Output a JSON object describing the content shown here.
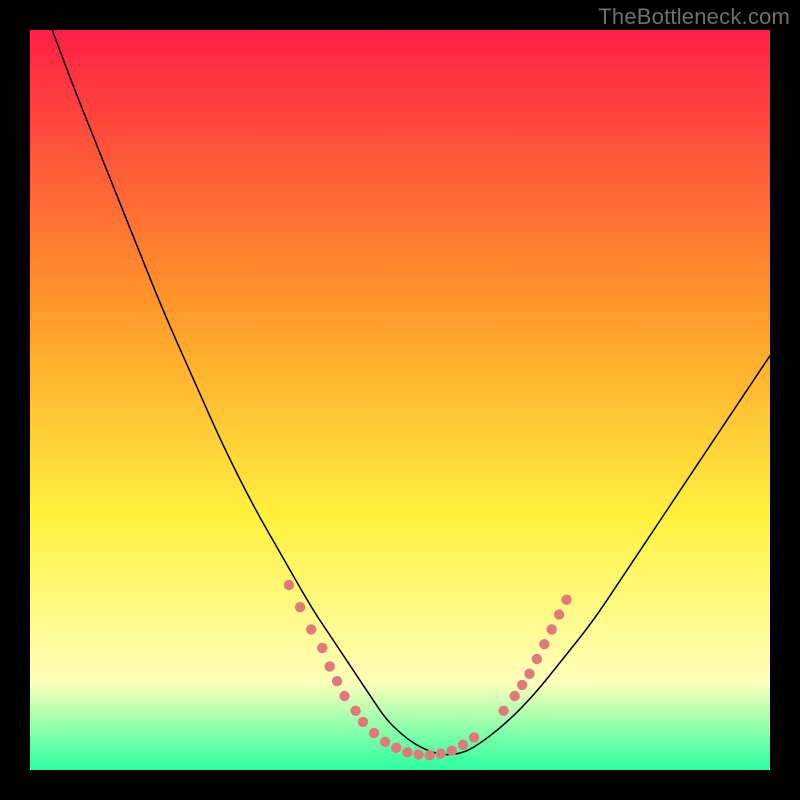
{
  "watermark": "TheBottleneck.com",
  "chart_data": {
    "type": "line",
    "title": "",
    "xlabel": "",
    "ylabel": "",
    "xlim": [
      0,
      100
    ],
    "ylim": [
      0,
      100
    ],
    "grid": false,
    "legend": false,
    "background_gradient": {
      "top": "#ff1f46",
      "mid1": "#ff9a2a",
      "mid2": "#fff23e",
      "mid3": "#ffffbb",
      "bottom": "#2aff9f"
    },
    "series": [
      {
        "name": "bottleneck-curve",
        "color": "#000000",
        "stroke_width": 1.5,
        "x": [
          3,
          6,
          10,
          14,
          18,
          22,
          26,
          30,
          34,
          38,
          40,
          42,
          44,
          46,
          48,
          50,
          52,
          54,
          56,
          58,
          60,
          64,
          68,
          72,
          76,
          80,
          84,
          88,
          92,
          96,
          100
        ],
        "y": [
          100,
          92,
          82,
          72,
          62,
          53,
          44,
          36,
          29,
          22,
          19,
          16,
          13,
          10,
          7,
          5,
          3.5,
          2.5,
          2,
          2.2,
          3,
          6,
          10,
          15,
          20,
          26,
          32,
          38,
          44,
          50,
          56
        ]
      }
    ],
    "markers": {
      "name": "highlight-dots",
      "color": "#e07a7a",
      "radius": 5.2,
      "threshold_y": 24,
      "points": [
        {
          "x": 35,
          "y": 25
        },
        {
          "x": 36.5,
          "y": 22
        },
        {
          "x": 38,
          "y": 19
        },
        {
          "x": 39.5,
          "y": 16.5
        },
        {
          "x": 40.5,
          "y": 14
        },
        {
          "x": 41.5,
          "y": 12
        },
        {
          "x": 42.5,
          "y": 10
        },
        {
          "x": 44,
          "y": 8
        },
        {
          "x": 45,
          "y": 6.5
        },
        {
          "x": 46.5,
          "y": 5
        },
        {
          "x": 48,
          "y": 3.8
        },
        {
          "x": 49.5,
          "y": 3
        },
        {
          "x": 51,
          "y": 2.4
        },
        {
          "x": 52.5,
          "y": 2.1
        },
        {
          "x": 54,
          "y": 2
        },
        {
          "x": 55.5,
          "y": 2.2
        },
        {
          "x": 57,
          "y": 2.6
        },
        {
          "x": 58.5,
          "y": 3.4
        },
        {
          "x": 60,
          "y": 4.4
        },
        {
          "x": 64,
          "y": 8
        },
        {
          "x": 65.5,
          "y": 10
        },
        {
          "x": 66.5,
          "y": 11.5
        },
        {
          "x": 67.5,
          "y": 13
        },
        {
          "x": 68.5,
          "y": 15
        },
        {
          "x": 69.5,
          "y": 17
        },
        {
          "x": 70.5,
          "y": 19
        },
        {
          "x": 71.5,
          "y": 21
        },
        {
          "x": 72.5,
          "y": 23
        }
      ]
    }
  }
}
